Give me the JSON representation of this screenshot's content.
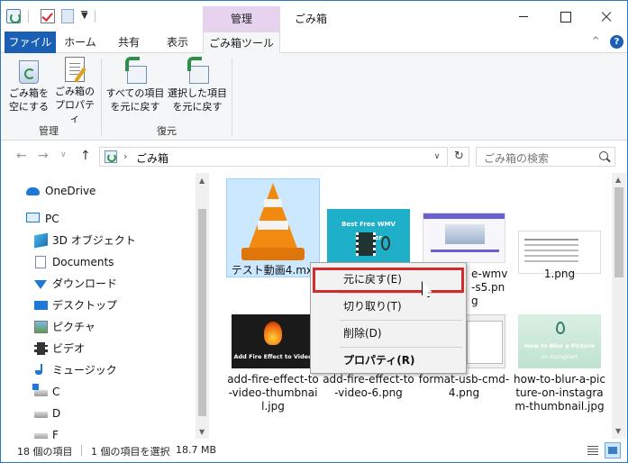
{
  "titlebar": {
    "context_tab_title": "管理",
    "window_title": "ごみ箱"
  },
  "ribbon": {
    "tabs": {
      "file": "ファイル",
      "home": "ホーム",
      "share": "共有",
      "view": "表示",
      "tools": "ごみ箱ツール"
    },
    "buttons": {
      "empty_line1": "ごみ箱を",
      "empty_line2": "空にする",
      "props_line1": "ごみ箱の",
      "props_line2": "プロパティ",
      "restore_all_line1": "すべての項目",
      "restore_all_line2": "を元に戻す",
      "restore_sel_line1": "選択した項目",
      "restore_sel_line2": "を元に戻す"
    },
    "groups": {
      "manage": "管理",
      "restore": "復元"
    },
    "help": "?"
  },
  "address": {
    "path": "ごみ箱",
    "search_placeholder": "ごみ箱の検索"
  },
  "nav": {
    "onedrive": "OneDrive",
    "pc": "PC",
    "objects3d": "3D オブジェクト",
    "documents": "Documents",
    "downloads": "ダウンロード",
    "desktop": "デスクトップ",
    "pictures": "ピクチャ",
    "videos": "ビデオ",
    "music": "ミュージック",
    "drive_c": "C",
    "drive_d": "D",
    "drive_f": "F"
  },
  "files": {
    "f1": "テスト動画4.mxf",
    "f2_thumb_title": "Best Free WMV Splitter",
    "f3": "e-wmv-s5.png",
    "f4": "1.png",
    "f5_thumb_text": "Add Fire Effect to Video",
    "f5": "add-fire-effect-to-video-thumbnail.jpg",
    "f6": "add-fire-effect-to-video-6.png",
    "f7": "format-usb-cmd-4.png",
    "f8_thumb_t1": "How to Blur a Picture",
    "f8_thumb_t2": "on Instagram",
    "f8": "how-to-blur-a-picture-on-instagram-thumbnail.jpg"
  },
  "context_menu": {
    "restore": "元に戻す(E)",
    "cut": "切り取り(T)",
    "delete": "削除(D)",
    "properties": "プロパティ(R)"
  },
  "status": {
    "count": "18 個の項目",
    "selected": "1 個の項目を選択",
    "size": "18.7 MB"
  },
  "colors": {
    "accent": "#1a5fb4",
    "context_tab": "#e7d2f0",
    "highlight": "#d42a2a",
    "selection": "#cce8ff"
  }
}
